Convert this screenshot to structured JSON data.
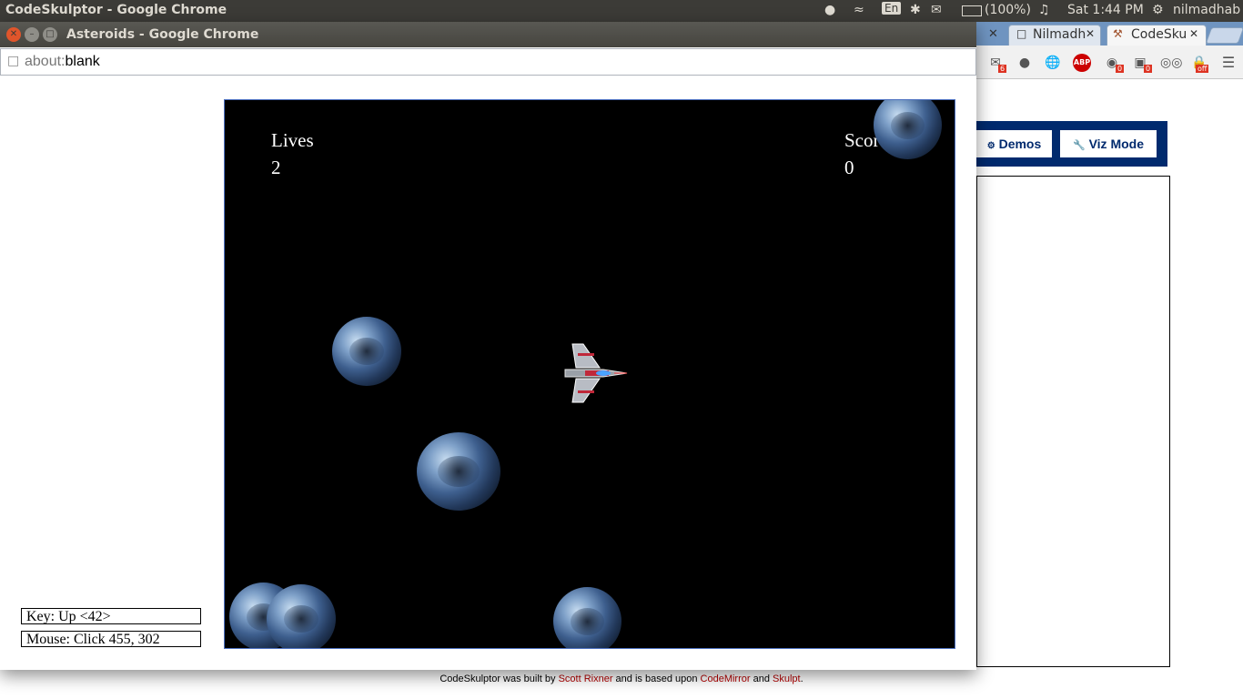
{
  "panel": {
    "title": "CodeSkulptor - Google Chrome",
    "battery": "(100%)",
    "clock": "Sat  1:44 PM",
    "user": "nilmadhab",
    "keyboard": "En"
  },
  "background_window": {
    "tabs": [
      "Nilmadh",
      "CodeSku"
    ],
    "extension_badges": [
      "6",
      "0",
      "0",
      "off"
    ],
    "buttons": {
      "demos": "Demos",
      "viz_mode": "Viz Mode"
    },
    "credits": {
      "prefix": "CodeSkulptor was built by ",
      "author": "Scott Rixner",
      "middle": " and is based upon ",
      "lib1": "CodeMirror",
      "and": " and ",
      "lib2": "Skulpt",
      "suffix": "."
    }
  },
  "window": {
    "title": "Asteroids - Google Chrome",
    "url_scheme": "about:",
    "url_rest": "blank"
  },
  "game": {
    "lives_label": "Lives",
    "lives_value": "2",
    "score_label": "Score",
    "score_value": "0",
    "background_color": "#000000"
  },
  "status": {
    "key": "Key: Up <42>",
    "mouse": "Mouse: Click 455, 302"
  }
}
